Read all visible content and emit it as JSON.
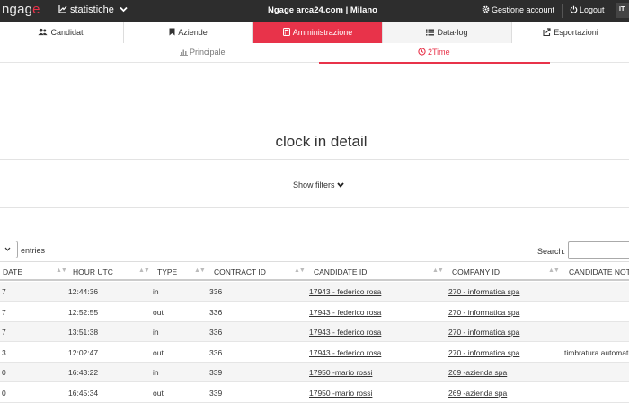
{
  "topbar": {
    "brand_prefix": "ngag",
    "brand_suffix": "e",
    "section": "statistiche",
    "center_title": "Ngage arca24.com | Milano",
    "account": "Gestione account",
    "logout": "Logout",
    "lang": "IT"
  },
  "tabs": [
    {
      "label": "Candidati",
      "icon": "users-icon"
    },
    {
      "label": "Aziende",
      "icon": "bookmark-icon"
    },
    {
      "label": "Amministrazione",
      "icon": "calculator-icon",
      "active": true
    },
    {
      "label": "Data-log",
      "icon": "list-icon"
    },
    {
      "label": "Esportazioni",
      "icon": "export-icon"
    }
  ],
  "subtabs": [
    {
      "label": "Principale",
      "icon": "bar-chart-icon"
    },
    {
      "label": "2Time",
      "icon": "clock-icon",
      "active": true
    }
  ],
  "page": {
    "title": "clock in detail",
    "show_filters": "Show filters",
    "entries_label": "entries",
    "search_label": "Search:"
  },
  "table": {
    "headers": [
      "DATE",
      "HOUR UTC",
      "TYPE",
      "CONTRACT ID",
      "CANDIDATE ID",
      "COMPANY ID",
      "CANDIDATE NOTE"
    ],
    "rows": [
      {
        "date": "7",
        "hour": "12:44:36",
        "type": "in",
        "contract": "336",
        "candidate": "17943 - federico rosa",
        "company": "270 - informatica spa",
        "note": ""
      },
      {
        "date": "7",
        "hour": "12:52:55",
        "type": "out",
        "contract": "336",
        "candidate": "17943 - federico rosa",
        "company": "270 - informatica spa",
        "note": ""
      },
      {
        "date": "7",
        "hour": "13:51:38",
        "type": "in",
        "contract": "336",
        "candidate": "17943 - federico rosa",
        "company": "270 - informatica spa",
        "note": ""
      },
      {
        "date": "3",
        "hour": "12:02:47",
        "type": "out",
        "contract": "336",
        "candidate": "17943 - federico rosa",
        "company": "270 - informatica spa",
        "note": "timbratura automatica"
      },
      {
        "date": "0",
        "hour": "16:43:22",
        "type": "in",
        "contract": "339",
        "candidate": "17950 -mario rossi",
        "company": "269 -azienda spa",
        "note": ""
      },
      {
        "date": "0",
        "hour": "16:45:34",
        "type": "out",
        "contract": "339",
        "candidate": "17950 -mario rossi",
        "company": "269 -azienda spa",
        "note": ""
      }
    ]
  },
  "colors": {
    "accent": "#e8334a",
    "topbar": "#2d2d2d"
  }
}
